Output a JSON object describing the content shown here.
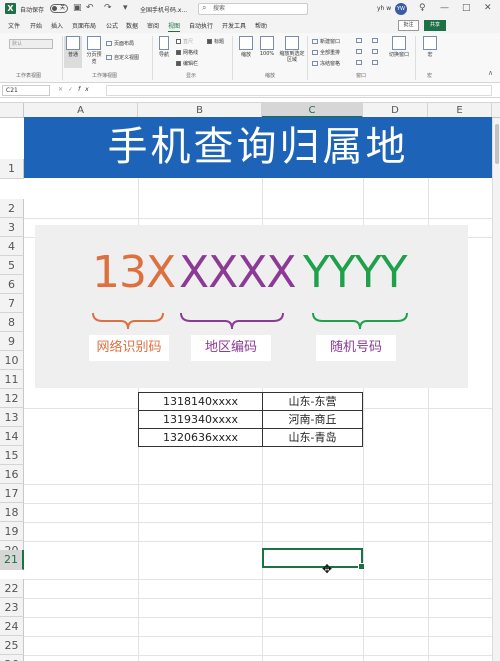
{
  "titlebar": {
    "autosave_label": "自动保存",
    "autosave_state": "关",
    "filename": "全国手机号码.x...",
    "search_placeholder": "搜索",
    "user_initials": "yh w",
    "avatar_text": "YW"
  },
  "menu": {
    "tabs": [
      "文件",
      "开始",
      "插入",
      "页面布局",
      "公式",
      "数据",
      "审阅",
      "视图",
      "自动执行",
      "开发工具",
      "帮助"
    ],
    "active_tab": "视图",
    "comment_label": "批注",
    "share_label": "共享"
  },
  "ribbon": {
    "view_dropdown": "默认",
    "group_labels": {
      "sheet_view": "工作表视图",
      "workbook_views": "工作簿视图",
      "show": "显示",
      "zoom": "缩放",
      "window": "窗口",
      "macros": "宏"
    },
    "buttons": {
      "normal": "普通",
      "page_break": "分页预览",
      "page_layout": "页面布局",
      "custom_views": "自定义视图",
      "navigation": "导航",
      "zoom": "缩放",
      "zoom_100": "100%",
      "zoom_selection": "缩放到选定区域",
      "new_window": "新建窗口",
      "arrange_all": "全部重排",
      "freeze_panes": "冻结窗格",
      "switch_windows": "切换窗口",
      "macros": "宏"
    },
    "checkboxes": {
      "ruler": "直尺",
      "gridlines": "网格线",
      "formula_bar": "编辑栏",
      "headings": "标题"
    }
  },
  "formulabar": {
    "namebox": "C21",
    "fx": "fx",
    "value": ""
  },
  "columns": [
    "A",
    "B",
    "C",
    "D",
    "E"
  ],
  "selected_column": "C",
  "rows": [
    "1",
    "2",
    "3",
    "4",
    "5",
    "6",
    "7",
    "8",
    "9",
    "10",
    "11",
    "12",
    "13",
    "14",
    "15",
    "16",
    "17",
    "18",
    "19",
    "20",
    "21",
    "22",
    "23",
    "24",
    "25",
    "26"
  ],
  "selected_row": "21",
  "banner_title": "手机查询归属地",
  "explainer": {
    "part1_code": "13X",
    "part2_code": "XXXX",
    "part3_code": "YYYY",
    "part1_label": "网络识别码",
    "part2_label": "地区编码",
    "part3_label": "随机号码",
    "colors": {
      "part1": "#de6f3f",
      "part2": "#8b3a96",
      "part3": "#1fa04a"
    }
  },
  "table": [
    {
      "number": "1318140xxxx",
      "location": "山东-东营"
    },
    {
      "number": "1319340xxxx",
      "location": "河南-商丘"
    },
    {
      "number": "1320636xxxx",
      "location": "山东-青岛"
    }
  ]
}
